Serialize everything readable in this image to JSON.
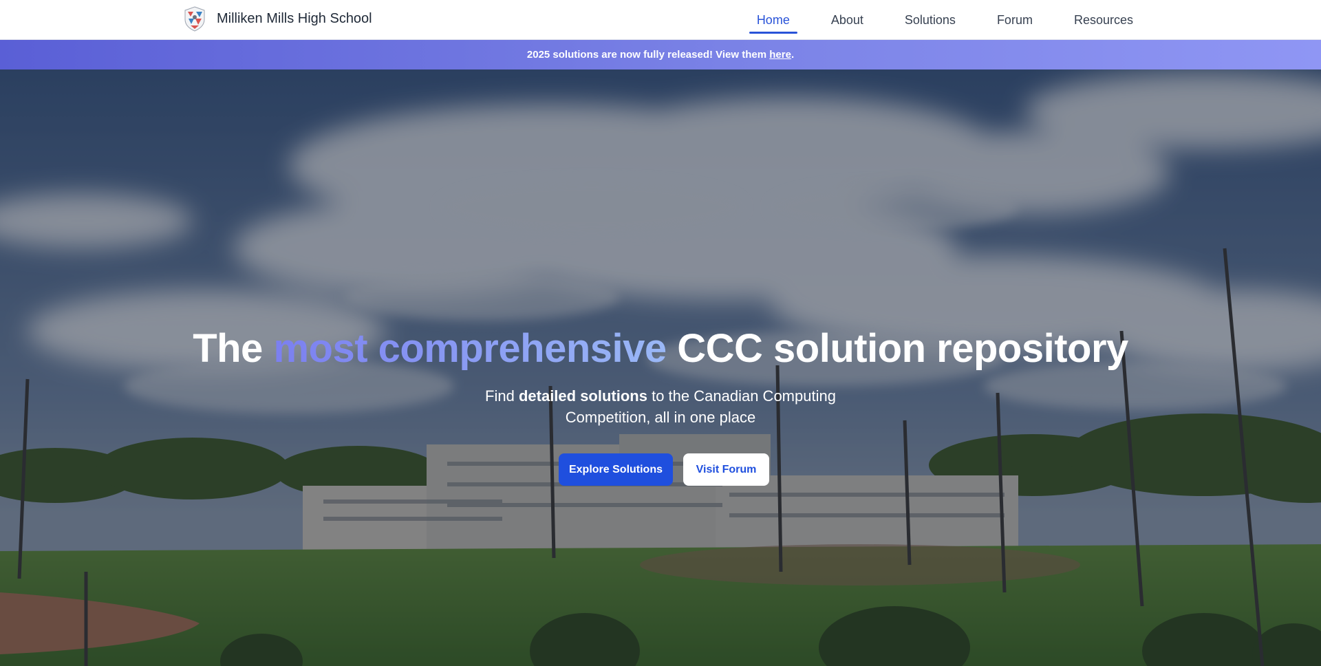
{
  "brand": {
    "name": "Milliken Mills High School"
  },
  "nav": {
    "items": [
      {
        "label": "Home",
        "active": true
      },
      {
        "label": "About"
      },
      {
        "label": "Solutions"
      },
      {
        "label": "Forum"
      },
      {
        "label": "Resources"
      }
    ]
  },
  "banner": {
    "text_before": "2025 solutions are now fully released! View them ",
    "link_text": "here",
    "text_after": "."
  },
  "hero": {
    "title_part1": "The ",
    "title_highlight": "most comprehensive",
    "title_part2": " CCC solution repository",
    "sub_before": "Find ",
    "sub_bold": "detailed solutions",
    "sub_after": " to the Canadian Computing Competition, all in one place",
    "primary_button": "Explore Solutions",
    "secondary_button": "Visit Forum"
  },
  "colors": {
    "accent": "#2953d8",
    "banner_start": "#5a5fd6",
    "banner_end": "#8f96f4",
    "highlight_start": "#7b7ff0",
    "highlight_end": "#9ab8f6"
  }
}
